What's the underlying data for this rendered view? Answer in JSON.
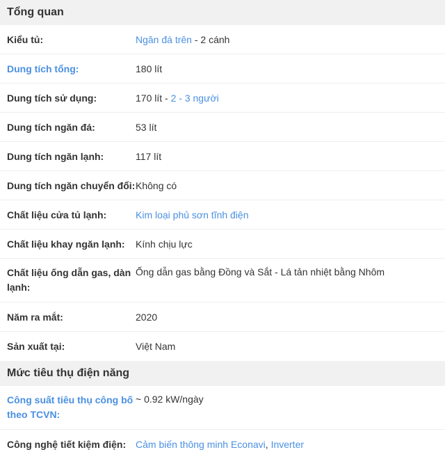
{
  "overview": {
    "title": "Tổng quan",
    "rows": [
      {
        "label": "Kiểu tủ:",
        "value_link": "Ngăn đá trên",
        "value_text": " - 2 cánh"
      },
      {
        "label": "Dung tích tổng:",
        "value": "180 lít"
      },
      {
        "label": "Dung tích sử dụng:",
        "value_text": "170 lít - ",
        "value_link": "2 - 3 người"
      },
      {
        "label": "Dung tích ngăn đá:",
        "value": "53 lít"
      },
      {
        "label": "Dung tích ngăn lạnh:",
        "value": "117 lít"
      },
      {
        "label": "Dung tích ngăn chuyển đổi:",
        "value": "Không có"
      },
      {
        "label": "Chất liệu cửa tủ lạnh:",
        "value_link": "Kim loại phủ sơn tĩnh điện"
      },
      {
        "label": "Chất liệu khay ngăn lạnh:",
        "value": "Kính chịu lực"
      },
      {
        "label_line1": "Chất liệu ống dẫn gas, dàn",
        "label_line2": "lạnh:",
        "value": "Ống dẫn gas bằng Đồng và Sắt - Lá tản nhiệt bằng Nhôm"
      },
      {
        "label": "Năm ra mắt:",
        "value": "2020"
      },
      {
        "label": "Sản xuất tại:",
        "value": "Việt Nam"
      }
    ]
  },
  "power": {
    "title": "Mức tiêu thụ điện năng",
    "rows": [
      {
        "label_line1": "Công suất tiêu thụ công bố",
        "label_line2": "theo TCVN:",
        "value": "~ 0.92 kW/ngày"
      },
      {
        "label": "Công nghệ tiết kiệm điện:",
        "value_link1": "Cảm biến thông minh Econavi",
        "value_sep": ", ",
        "value_link2": "Inverter"
      }
    ]
  },
  "colors": {
    "link": "#4a90e2",
    "header_bg": "#f1f1f1",
    "text": "#333333",
    "divider": "#eeeeee"
  }
}
